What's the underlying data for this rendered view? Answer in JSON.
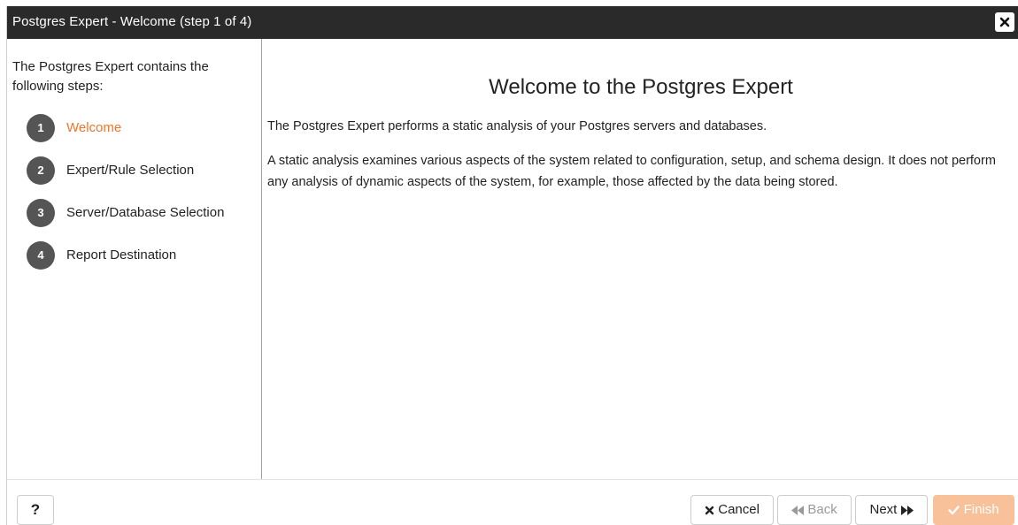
{
  "dialog": {
    "title": "Postgres Expert - Welcome (step 1 of 4)",
    "close_icon": "close-icon"
  },
  "sidebar": {
    "intro": "The Postgres Expert contains the following steps:",
    "steps": [
      {
        "number": "1",
        "label": "Welcome",
        "active": true
      },
      {
        "number": "2",
        "label": "Expert/Rule Selection",
        "active": false
      },
      {
        "number": "3",
        "label": "Server/Database Selection",
        "active": false
      },
      {
        "number": "4",
        "label": "Report Destination",
        "active": false
      }
    ]
  },
  "content": {
    "heading": "Welcome to the Postgres Expert",
    "paragraph1": "The Postgres Expert performs a static analysis of your Postgres servers and databases.",
    "paragraph2": "A static analysis examines various aspects of the system related to configuration, setup, and schema design. It does not perform any analysis of dynamic aspects of the system, for example, those affected by the data being stored."
  },
  "footer": {
    "help_label": "?",
    "cancel_label": "Cancel",
    "back_label": "Back",
    "next_label": "Next",
    "finish_label": "Finish"
  },
  "colors": {
    "accent": "#f0762b",
    "titlebar": "#2a2a2a",
    "step_circle": "#555555",
    "finish_disabled": "#f8c199"
  }
}
